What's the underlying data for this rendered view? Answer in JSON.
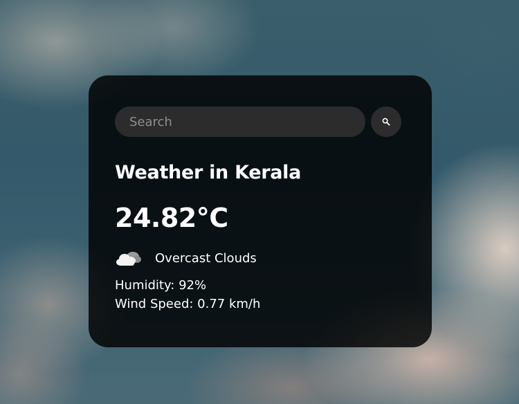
{
  "search": {
    "placeholder": "Search",
    "button_icon": "search-icon"
  },
  "weather": {
    "title": "Weather in Kerala",
    "temperature": "24.82°C",
    "icon": "overcast-clouds-icon",
    "description": "Overcast Clouds",
    "humidity": "Humidity: 92%",
    "wind_speed": "Wind Speed: 0.77 km/h"
  }
}
